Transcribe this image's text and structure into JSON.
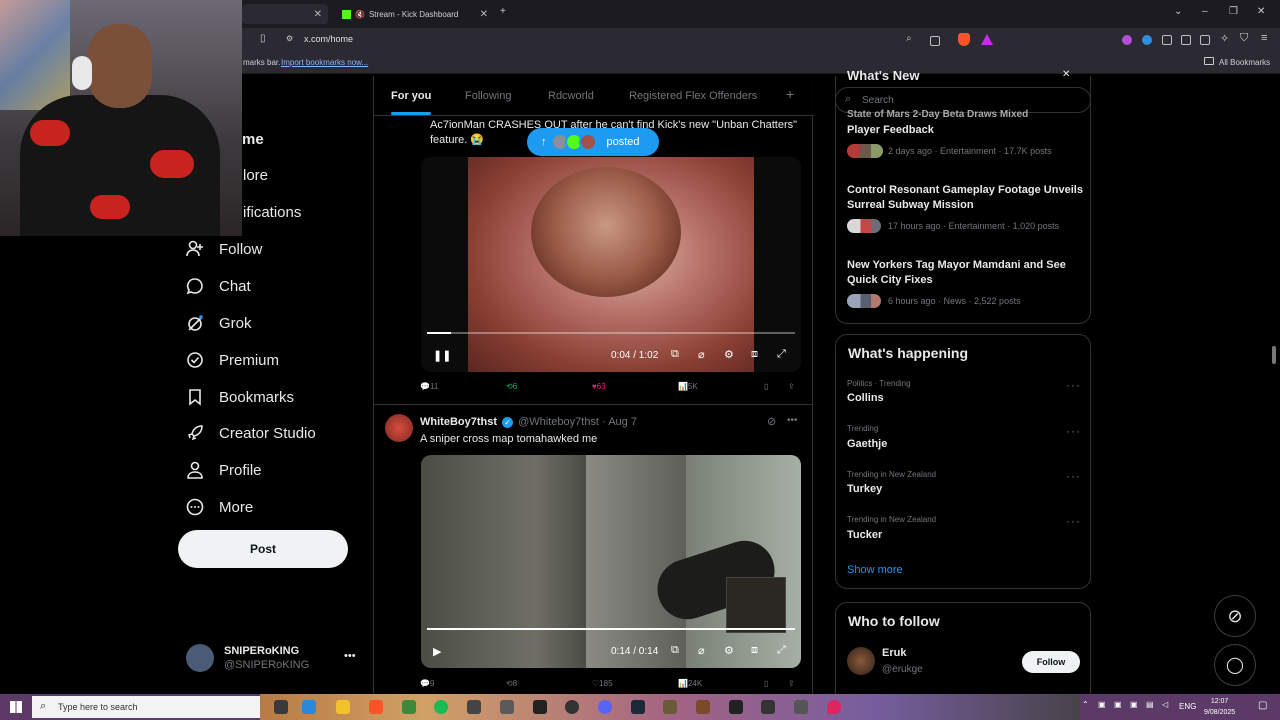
{
  "browser": {
    "tabs": [
      {
        "label": "",
        "active": true
      },
      {
        "label": "Stream - Kick Dashboard",
        "active": false
      }
    ],
    "url": "x.com/home",
    "bookmarks_hint": "marks bar.",
    "bookmarks_link": "Import bookmarks now...",
    "all_bookmarks": "All Bookmarks"
  },
  "sidebar": {
    "partial_items": [
      "me",
      "lore",
      "ifications"
    ],
    "items": [
      {
        "label": "Follow",
        "icon": "follow-icon"
      },
      {
        "label": "Chat",
        "icon": "chat-icon"
      },
      {
        "label": "Grok",
        "icon": "grok-icon"
      },
      {
        "label": "Premium",
        "icon": "premium-icon"
      },
      {
        "label": "Bookmarks",
        "icon": "bookmark-icon"
      },
      {
        "label": "Creator Studio",
        "icon": "rocket-icon"
      },
      {
        "label": "Profile",
        "icon": "person-icon"
      },
      {
        "label": "More",
        "icon": "more-icon"
      }
    ],
    "post_label": "Post",
    "profile_name": "SNIPERoKING",
    "profile_handle": "@SNIPERoKING"
  },
  "feed": {
    "tabs": [
      "For you",
      "Following",
      "Rdcworld",
      "Registered Flex Offenders"
    ],
    "active_tab": "For you",
    "posted_pill": "posted",
    "tweet1": {
      "text_line1": "Ac7ionMan CRASHES OUT after he can't find Kick's new \"Unban Chatters\"",
      "text_line2": "feature. 😭",
      "video_time": "0:04 / 1:02",
      "video_progress": 0.065,
      "replies": "11",
      "reposts": "6",
      "likes": "63",
      "views": "5K"
    },
    "tweet2": {
      "author": "WhiteBoy7thst",
      "handle": "@Whiteboy7thst",
      "date": "Aug 7",
      "text": "A sniper cross map tomahawked me",
      "video_time": "0:14 / 0:14",
      "video_progress": 1.0,
      "replies": "9",
      "reposts": "8",
      "likes": "185",
      "views": "24K"
    }
  },
  "right": {
    "search_placeholder": "Search",
    "news_header_partial": "What's New",
    "news": [
      {
        "title": "Player Feedback",
        "title_partial": "State of Mars 2-Day Beta Draws Mixed",
        "meta": "2 days ago · Entertainment · 17.7K posts"
      },
      {
        "title": "Control Resonant Gameplay Footage Unveils Surreal Subway Mission",
        "meta": "17 hours ago · Entertainment · 1,020 posts"
      },
      {
        "title": "New Yorkers Tag Mayor Mamdani and See Quick City Fixes",
        "meta": "6 hours ago · News · 2,522 posts"
      }
    ],
    "happening_title": "What's happening",
    "trends": [
      {
        "category": "Politics · Trending",
        "name": "Collins"
      },
      {
        "category": "Trending",
        "name": "Gaethje"
      },
      {
        "category": "Trending in New Zealand",
        "name": "Turkey"
      },
      {
        "category": "Trending in New Zealand",
        "name": "Tucker"
      }
    ],
    "show_more": "Show more",
    "who_to_follow_title": "Who to follow",
    "suggest_name": "Eruk",
    "suggest_handle": "@erukge",
    "follow_label": "Follow"
  },
  "taskbar": {
    "search_placeholder": "Type here to search",
    "lang": "ENG",
    "time": "12:07",
    "date": "9/08/2025"
  }
}
